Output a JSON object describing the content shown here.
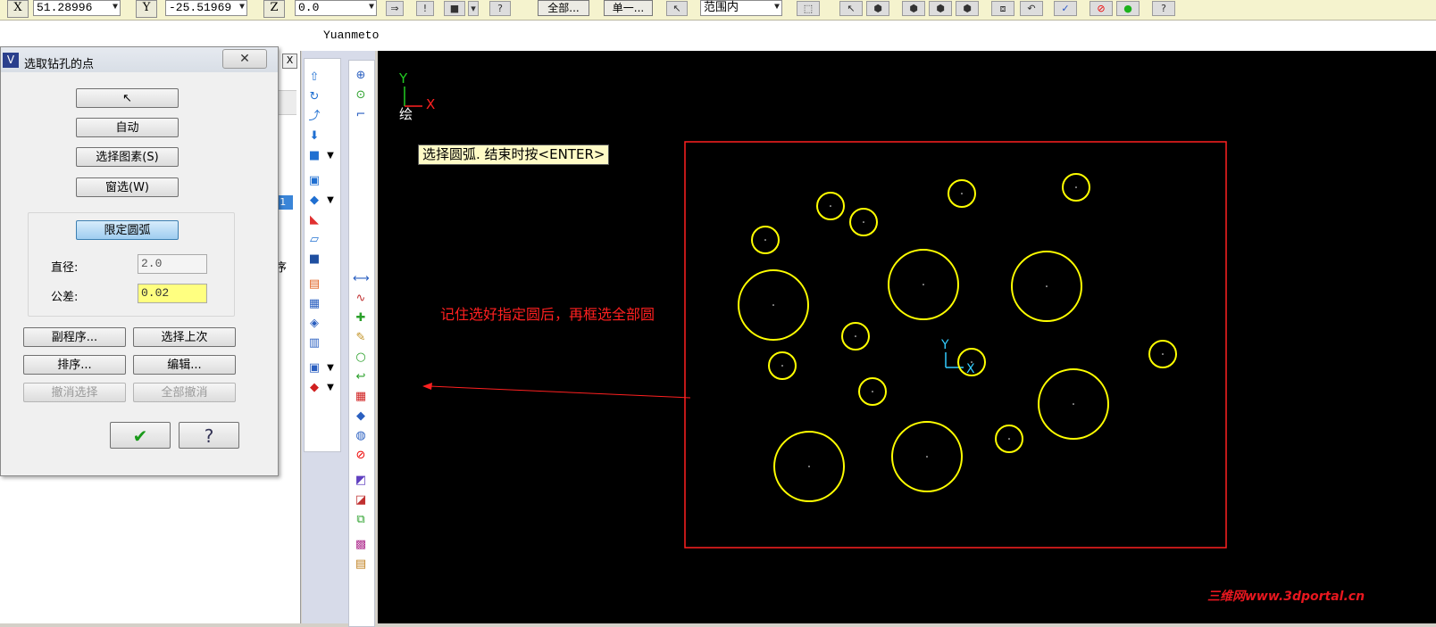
{
  "toolbar": {
    "x_label": "X",
    "x_value": "51.28996",
    "y_label": "Y",
    "y_value": "-25.51969",
    "z_label": "Z",
    "z_value": "0.0",
    "all_button": "全部...",
    "single_button": "单一...",
    "range_select": "范围内"
  },
  "window": {
    "title": "Yuanmeto"
  },
  "dialog": {
    "title": "选取钻孔的点",
    "close_glyph": "✕",
    "btn_auto": "自动",
    "btn_select_entity": "选择图素(S)",
    "btn_window_select": "窗选(W)",
    "btn_limit_arc": "限定圆弧",
    "diameter_label": "直径:",
    "diameter_value": "2.0",
    "tolerance_label": "公差:",
    "tolerance_value": "0.02",
    "btn_subprogram": "副程序...",
    "btn_select_last": "选择上次",
    "btn_sort": "排序...",
    "btn_edit": "编辑...",
    "btn_undo_select": "撤消选择",
    "btn_undo_all": "全部撤消",
    "btn_ok_glyph": "✔",
    "btn_help_glyph": "?"
  },
  "left_panel": {
    "close_glyph": "X",
    "partial_item": ": 1",
    "partial_order": "序"
  },
  "canvas": {
    "axis_y": "Y",
    "axis_x": "X",
    "view_label": "绘",
    "origin_y": "Y",
    "origin_x": "X",
    "prompt": "选择圆弧. 结束时按<ENTER>",
    "annotation": "记住选好指定圆后，再框选全部圆",
    "watermark": "三维网www.3dportal.cn"
  },
  "colors": {
    "canvas_bg": "#000000",
    "arc_color": "#ffff00",
    "selection_box": "#ff2020",
    "annotation": "#ff2020",
    "axis_y": "#22cc22",
    "axis_x": "#ff2020",
    "origin_axes": "#33ccff"
  }
}
